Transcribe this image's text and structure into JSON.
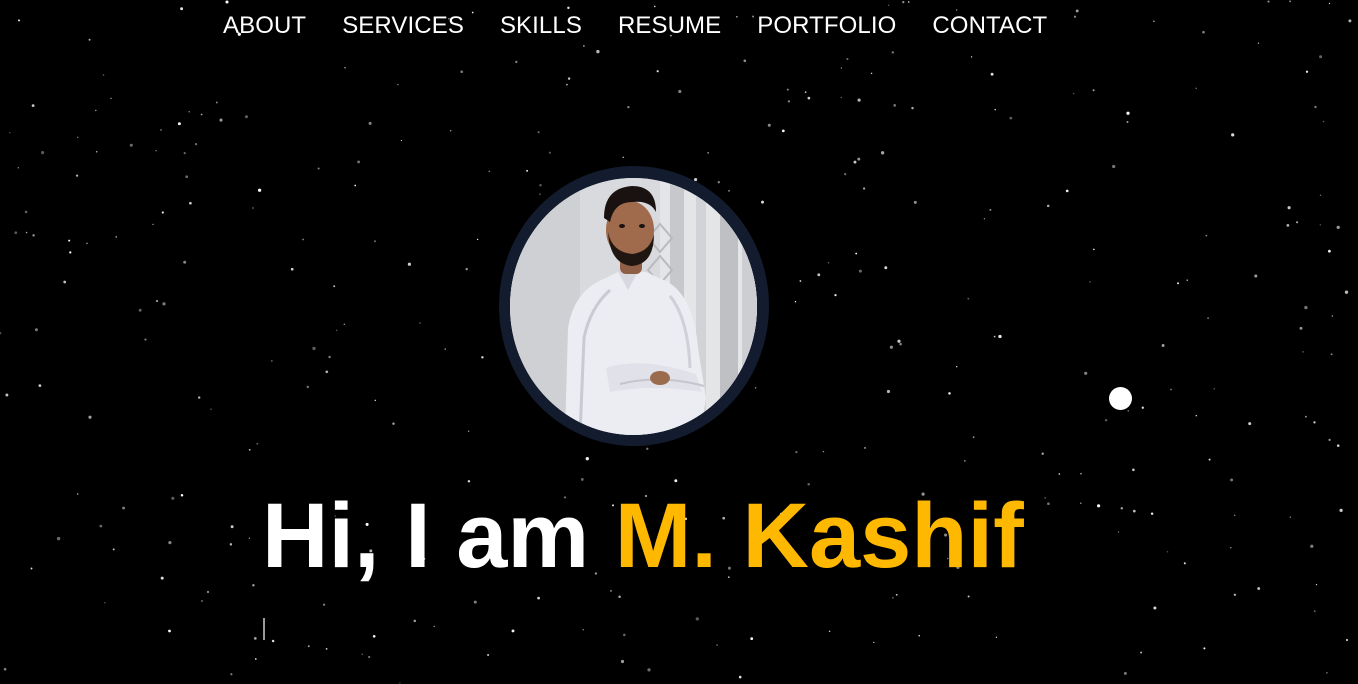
{
  "nav": {
    "items": [
      {
        "label": "ABOUT"
      },
      {
        "label": "SERVICES"
      },
      {
        "label": "SKILLS"
      },
      {
        "label": "RESUME"
      },
      {
        "label": "PORTFOLIO"
      },
      {
        "label": "CONTACT"
      }
    ]
  },
  "hero": {
    "greeting": "Hi, I am ",
    "name": "M. Kashif",
    "name_color": "#ffb800"
  },
  "theme": {
    "background": "#000000",
    "avatar_ring": "#131c2e"
  }
}
